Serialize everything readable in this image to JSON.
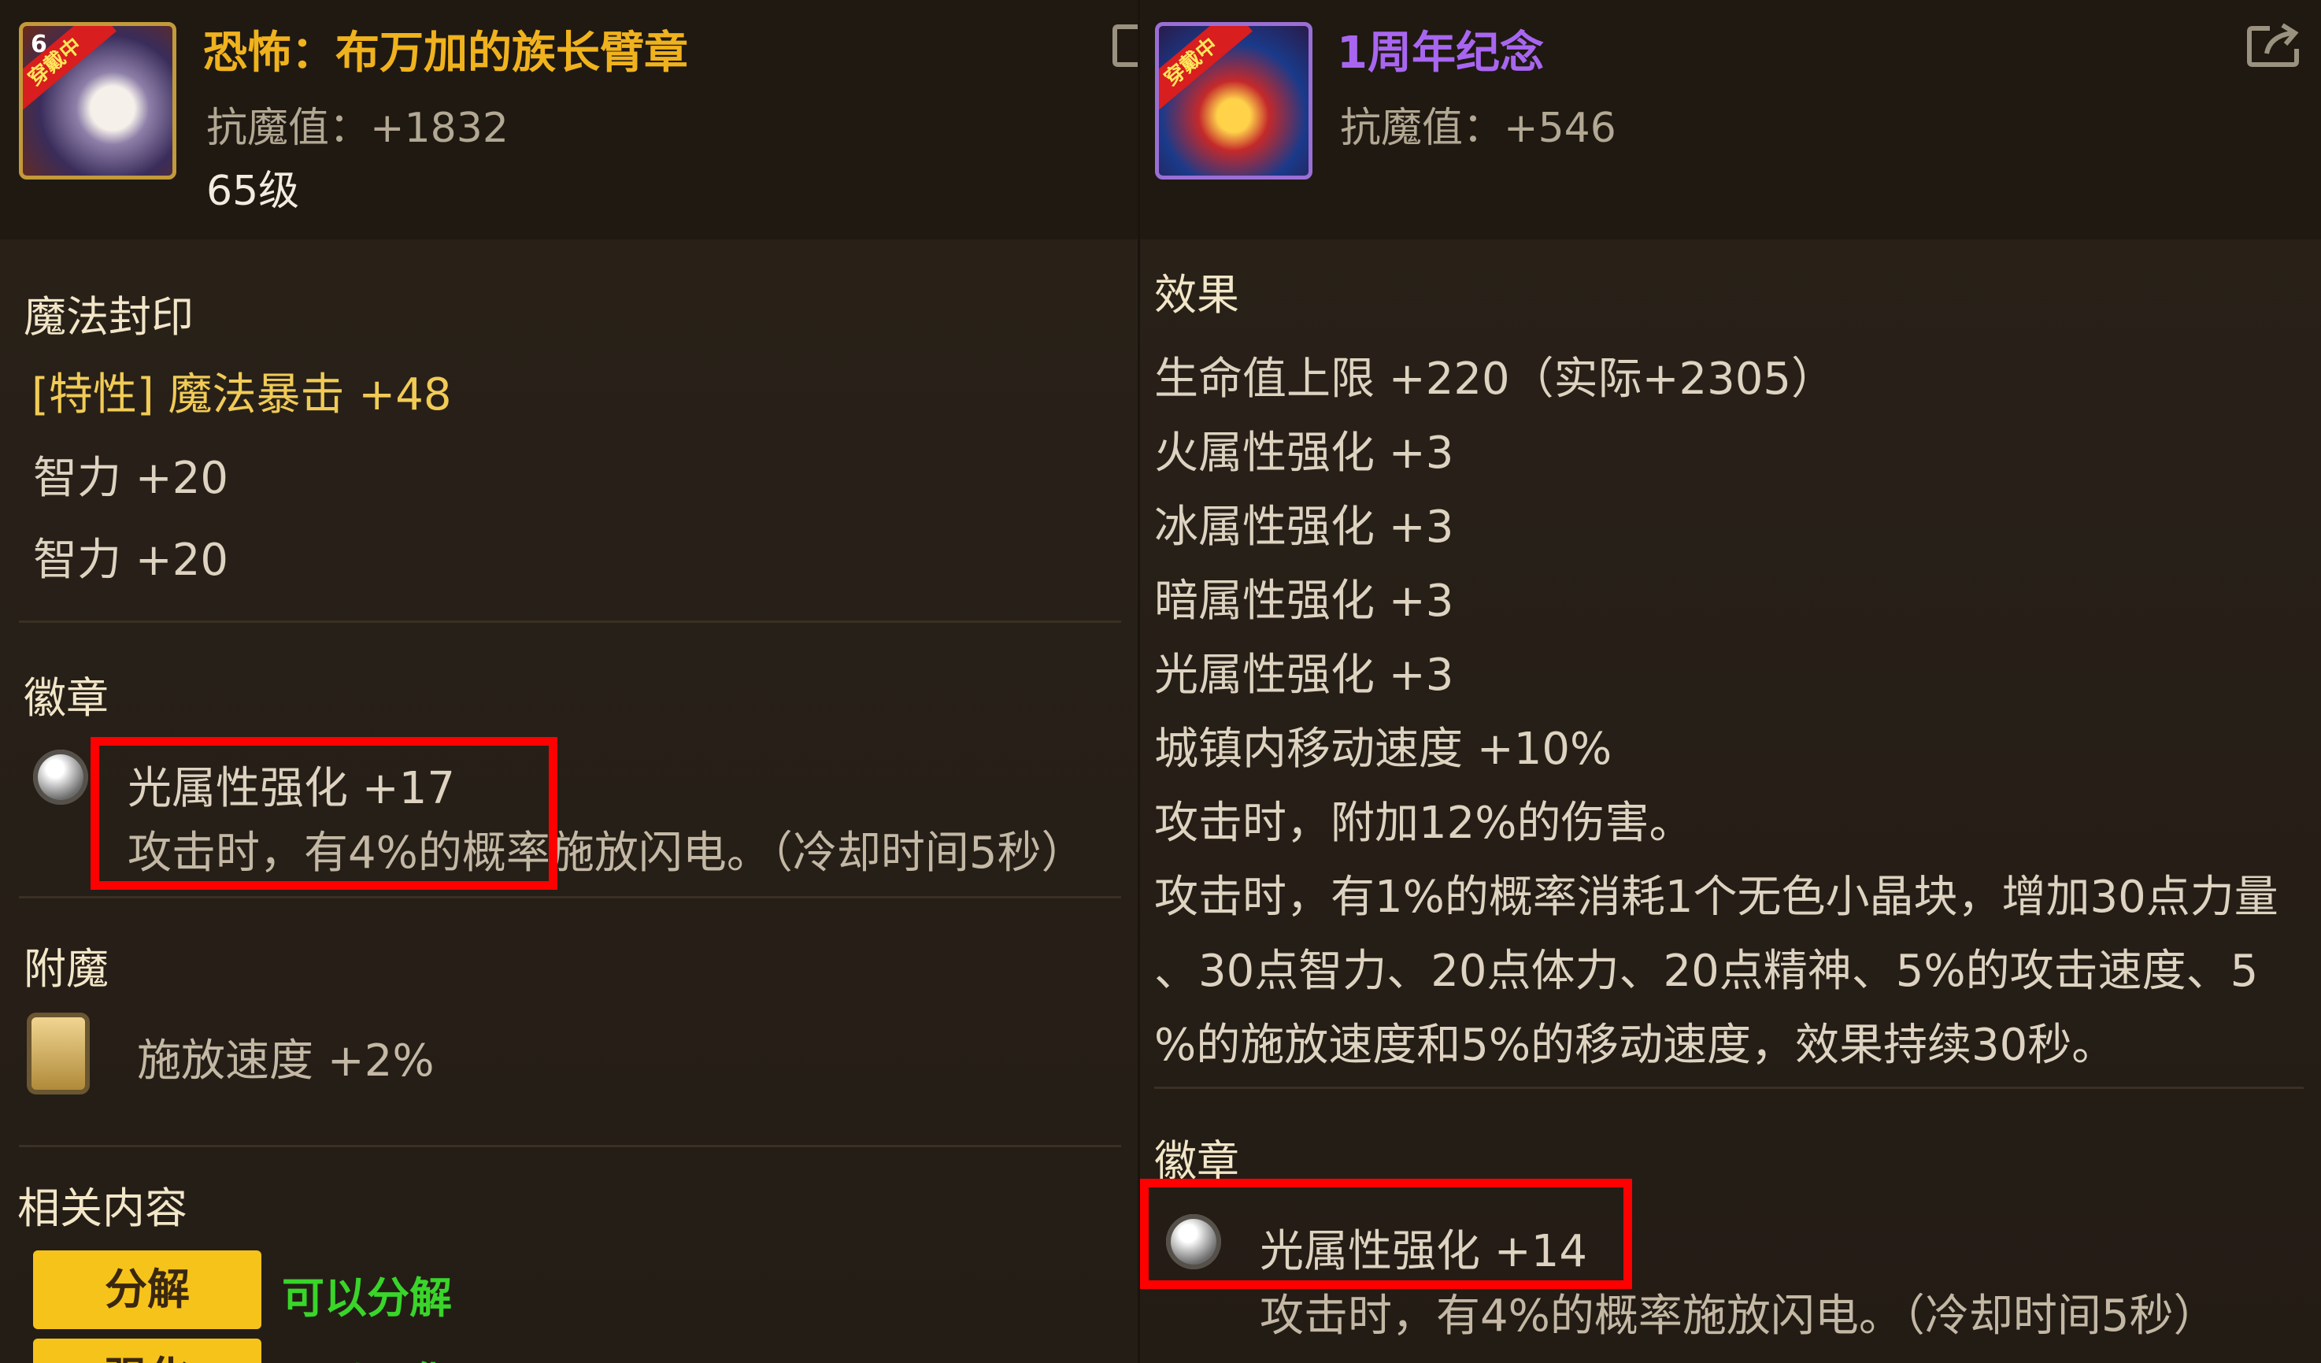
{
  "left": {
    "icon_badge": "穿戴中",
    "icon_level": "6",
    "title": "恐怖：布万加的族长臂章",
    "stat": "抗魔值：+1832",
    "level": "65级",
    "magic_seal": {
      "heading": "魔法封印",
      "lines": [
        "[特性] 魔法暴击 +48",
        "智力 +20",
        "智力 +20"
      ]
    },
    "emblem": {
      "heading": "徽章",
      "line1": "光属性强化 +17",
      "line2": "攻击时，有4%的概率施放闪电。（冷却时间5秒）"
    },
    "enchant": {
      "heading": "附魔",
      "line": "施放速度 +2%"
    },
    "related": {
      "heading": "相关内容",
      "button1": "分解",
      "status1": "可以分解",
      "button2": "强化",
      "status2": "可以强化"
    }
  },
  "right": {
    "icon_badge": "穿戴中",
    "title": "1周年纪念",
    "stat": "抗魔值：+546",
    "effect": {
      "heading": "效果",
      "lines": [
        "生命值上限 +220（实际+2305）",
        "火属性强化 +3",
        "冰属性强化 +3",
        "暗属性强化 +3",
        "光属性强化 +3",
        "城镇内移动速度 +10%",
        "攻击时，附加12%的伤害。",
        "攻击时，有1%的概率消耗1个无色小晶块，增加30点力量",
        "、30点智力、20点体力、20点精神、5%的攻击速度、5",
        "%的施放速度和5%的移动速度，效果持续30秒。"
      ]
    },
    "emblem": {
      "heading": "徽章",
      "line1": "光属性强化 +14",
      "line2": "攻击时，有4%的概率施放闪电。（冷却时间5秒）"
    }
  },
  "colors": {
    "highlight": "#ff0000",
    "title_gold": "#f0b21d",
    "title_purple": "#a866f0",
    "status_green": "#39d52a",
    "button_yellow": "#f6c31a"
  }
}
